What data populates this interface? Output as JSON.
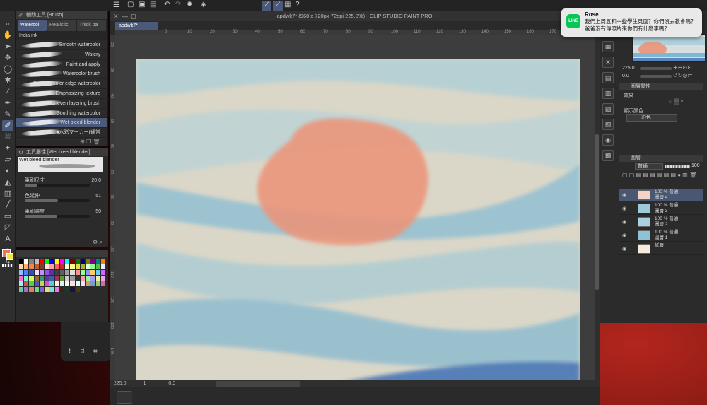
{
  "app": {
    "window_title": "apdwk7* (960 x 720px 72dpi 225.0%) - CLIP STUDIO PAINT PRO",
    "doc_tab": "apdwk7*"
  },
  "notification": {
    "app_icon_label": "LINE",
    "sender": "Rose",
    "message": "我們上周五和一些學生見面？你們沒去教會嗎？爸爸沒有傳照片來你們有什麼事嗎？"
  },
  "brush_panel": {
    "header": "輔助工具 [Brush]",
    "tabs": [
      "Watercol",
      "Realistic",
      "Thick pa"
    ],
    "subtab": "India ink",
    "brushes": [
      "Smooth watercolor",
      "Watery",
      "Paint and apply",
      "Watercolor brush",
      "Running color edge watercolor",
      "Emphasizing texture",
      "Uneven layering brush",
      "Soothing watercolor",
      "Wet bleed blender",
      "■水彩マーカー(通常"
    ],
    "selected_index": 8
  },
  "tool_property": {
    "header": "工具屬性 [Wet bleed blender]",
    "preset": "Wet bleed blender",
    "brush_size_label": "筆刷尺寸",
    "brush_size_value": "20.0",
    "extend_label": "色延伸",
    "extend_value": "51",
    "density_label": "筆刷濃度",
    "density_value": "50"
  },
  "right_panel": {
    "zoom": "225.0",
    "rotation": "0.0",
    "layer_prop_header": "圖層屬性",
    "effects_label": "效果",
    "display_color_label": "顯示顏色",
    "display_color_value": "彩色",
    "layers_header": "圖層",
    "blend_mode": "普通",
    "opacity": "100",
    "layers": [
      {
        "opacity_mode": "100 % 普通",
        "name": "圖層 4",
        "selected": true
      },
      {
        "opacity_mode": "100 % 普通",
        "name": "圖層 3",
        "selected": false
      },
      {
        "opacity_mode": "100 % 普通",
        "name": "圖層 2",
        "selected": false
      },
      {
        "opacity_mode": "100 % 普通",
        "name": "圖層 1",
        "selected": false
      },
      {
        "opacity_mode": "",
        "name": "紙張",
        "selected": false
      }
    ]
  },
  "statusbar": {
    "zoom": "225.0",
    "step": "1",
    "angle": "0.0"
  },
  "ruler_top": [
    "0",
    "10",
    "20",
    "30",
    "40",
    "50",
    "60",
    "70",
    "80",
    "90",
    "100",
    "110",
    "120",
    "130",
    "140",
    "150",
    "160",
    "170",
    "180",
    "190"
  ],
  "ruler_left": [
    "20",
    "30",
    "40",
    "50",
    "60",
    "70",
    "80",
    "90",
    "100",
    "110",
    "120",
    "130",
    "140"
  ],
  "colors": {
    "accent": "#4b5a7a",
    "foreground": "#e9775e",
    "background": "#f2e64a",
    "sun": "#ec8f72",
    "water_light": "#9ccad9",
    "water_dark": "#3f6fb4",
    "paper": "#d9d5c6",
    "line_green": "#06c755"
  },
  "palette_colors": [
    "#000000",
    "#ffffff",
    "#808080",
    "#c0c0c0",
    "#ff0000",
    "#00ff00",
    "#0000ff",
    "#ffff00",
    "#ff00ff",
    "#00ffff",
    "#800000",
    "#008000",
    "#000080",
    "#808000",
    "#800080",
    "#008080",
    "#ff8000",
    "#ffd8b0",
    "#ffb070",
    "#ff8040",
    "#c06030",
    "#804020",
    "#ffe0e0",
    "#ffa0a0",
    "#ff6060",
    "#c03030",
    "#ffffd0",
    "#ffff90",
    "#e0e050",
    "#b0b030",
    "#e0ffe0",
    "#90ff90",
    "#50c050",
    "#e0f0ff",
    "#90c0ff",
    "#5080ff",
    "#3050c0",
    "#f0e0ff",
    "#c090ff",
    "#9050e0",
    "#6030a0",
    "#404040",
    "#606060",
    "#a0a0a0",
    "#e0e0e0",
    "#ff9090",
    "#90ff90",
    "#9090ff",
    "#ffcc66",
    "#66ccff",
    "#cc66ff",
    "#ff66cc",
    "#66ffcc",
    "#ccff66",
    "#996633",
    "#339966",
    "#663399",
    "#336699",
    "#993366",
    "#669933",
    "#cccccc",
    "#999999",
    "#333333",
    "#f0a0a0",
    "#a0f0a0",
    "#a0a0f0",
    "#f0f0a0",
    "#f0a0f0",
    "#a0f0f0",
    "#d05050",
    "#50d050",
    "#5050d0",
    "#d0d050",
    "#d050d0",
    "#50d0d0",
    "#ffeedd",
    "#ddeeff",
    "#eeffdd",
    "#ffddee",
    "#ddffee",
    "#eeddff",
    "#c8a070",
    "#70a0c8",
    "#a0c870",
    "#c870a0",
    "#70c8a0",
    "#a070c8",
    "#e08060",
    "#60e080",
    "#8060e0",
    "#e0e080",
    "#80e0e0",
    "#e080e0",
    "#402010",
    "#104020",
    "#201040",
    "#404010"
  ]
}
